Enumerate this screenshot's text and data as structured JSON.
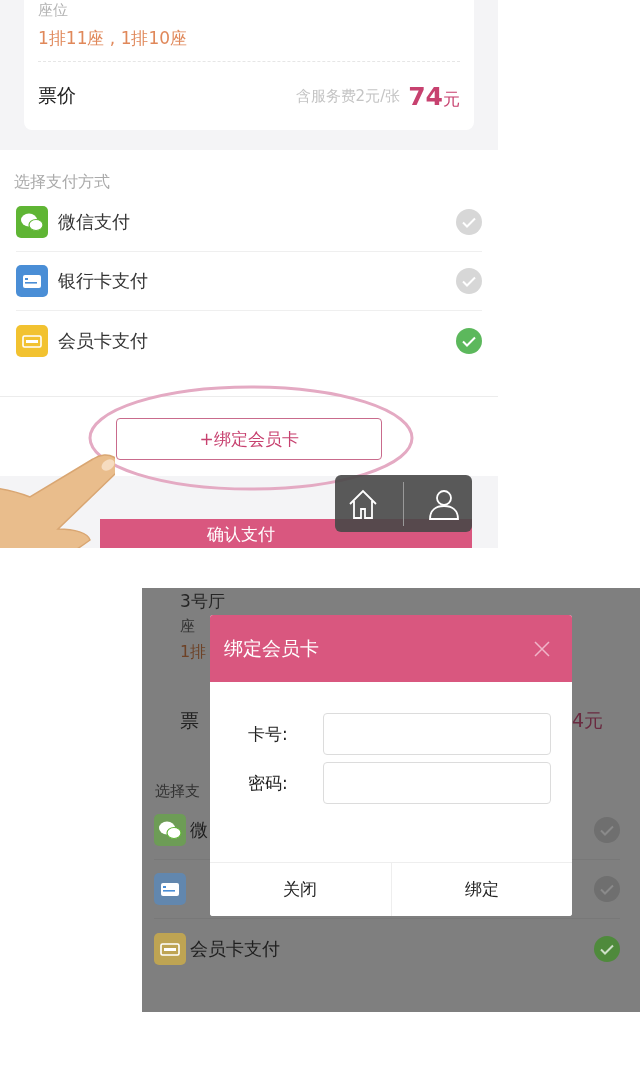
{
  "order": {
    "seat_label": "座位",
    "seats": "1排11座 , 1排10座",
    "price_label": "票价",
    "fee_note": "含服务费2元/张",
    "price": "74",
    "price_unit": "元"
  },
  "payment": {
    "heading": "选择支付方式",
    "methods": [
      {
        "kind": "wechat",
        "label": "微信支付",
        "selected": false
      },
      {
        "kind": "bank",
        "label": "银行卡支付",
        "selected": false
      },
      {
        "kind": "vip",
        "label": "会员卡支付",
        "selected": true
      }
    ]
  },
  "bind_button": "+绑定会员卡",
  "confirm_button": "确认支付",
  "dialog_screen": {
    "background": {
      "hall": "3号厅",
      "seat_label": "座",
      "seats": "1排",
      "price_label": "票",
      "price": "4元",
      "payment_heading": "选择支",
      "methods": [
        {
          "kind": "wechat",
          "label": "微",
          "selected": false
        },
        {
          "kind": "bank",
          "selected": false
        },
        {
          "kind": "vip",
          "label": "会员卡支付",
          "selected": true
        }
      ]
    },
    "dialog": {
      "title": "绑定会员卡",
      "fields": [
        {
          "label": "卡号:"
        },
        {
          "label": "密码:"
        }
      ],
      "buttons": [
        "关闭",
        "绑定"
      ]
    }
  }
}
